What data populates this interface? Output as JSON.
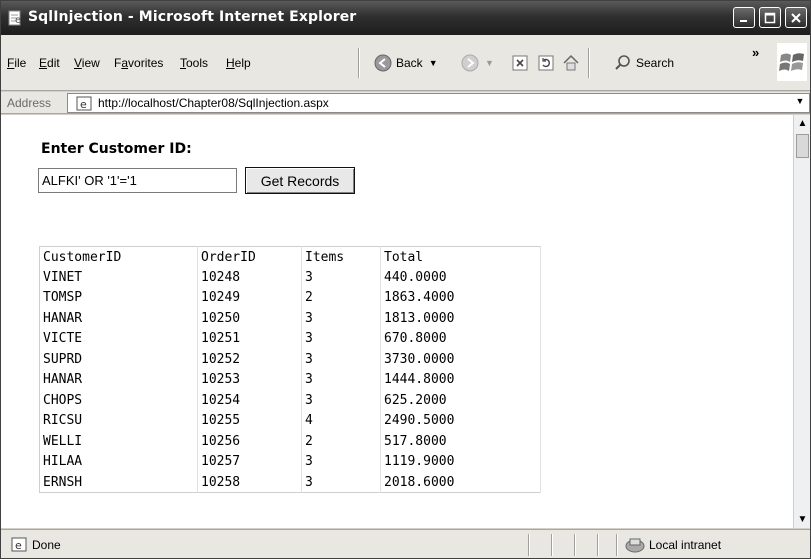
{
  "window": {
    "title": "SqlInjection - Microsoft Internet Explorer"
  },
  "menu": {
    "items": [
      {
        "label": "File",
        "underline": "F"
      },
      {
        "label": "Edit",
        "underline": "E"
      },
      {
        "label": "View",
        "underline": "V"
      },
      {
        "label": "Favorites",
        "underline": "a"
      },
      {
        "label": "Tools",
        "underline": "T"
      },
      {
        "label": "Help",
        "underline": "H"
      }
    ]
  },
  "toolbar": {
    "back_label": "Back",
    "search_label": "Search",
    "overflow": "»"
  },
  "address": {
    "label": "Address",
    "url": "http://localhost/Chapter08/SqlInjection.aspx"
  },
  "page": {
    "heading": "Enter Customer ID:",
    "customer_input_value": "ALFKI' OR '1'='1",
    "button_label": "Get Records",
    "columns": [
      "CustomerID",
      "OrderID",
      "Items",
      "Total"
    ],
    "rows": [
      [
        "VINET",
        "10248",
        "3",
        "440.0000"
      ],
      [
        "TOMSP",
        "10249",
        "2",
        "1863.4000"
      ],
      [
        "HANAR",
        "10250",
        "3",
        "1813.0000"
      ],
      [
        "VICTE",
        "10251",
        "3",
        "670.8000"
      ],
      [
        "SUPRD",
        "10252",
        "3",
        "3730.0000"
      ],
      [
        "HANAR",
        "10253",
        "3",
        "1444.8000"
      ],
      [
        "CHOPS",
        "10254",
        "3",
        "625.2000"
      ],
      [
        "RICSU",
        "10255",
        "4",
        "2490.5000"
      ],
      [
        "WELLI",
        "10256",
        "2",
        "517.8000"
      ],
      [
        "HILAA",
        "10257",
        "3",
        "1119.9000"
      ],
      [
        "ERNSH",
        "10258",
        "3",
        "2018.6000"
      ]
    ]
  },
  "status": {
    "text": "Done",
    "zone": "Local intranet"
  },
  "colors": {
    "titlebar": "#2f2f2f",
    "chrome": "#e9e7e2"
  }
}
